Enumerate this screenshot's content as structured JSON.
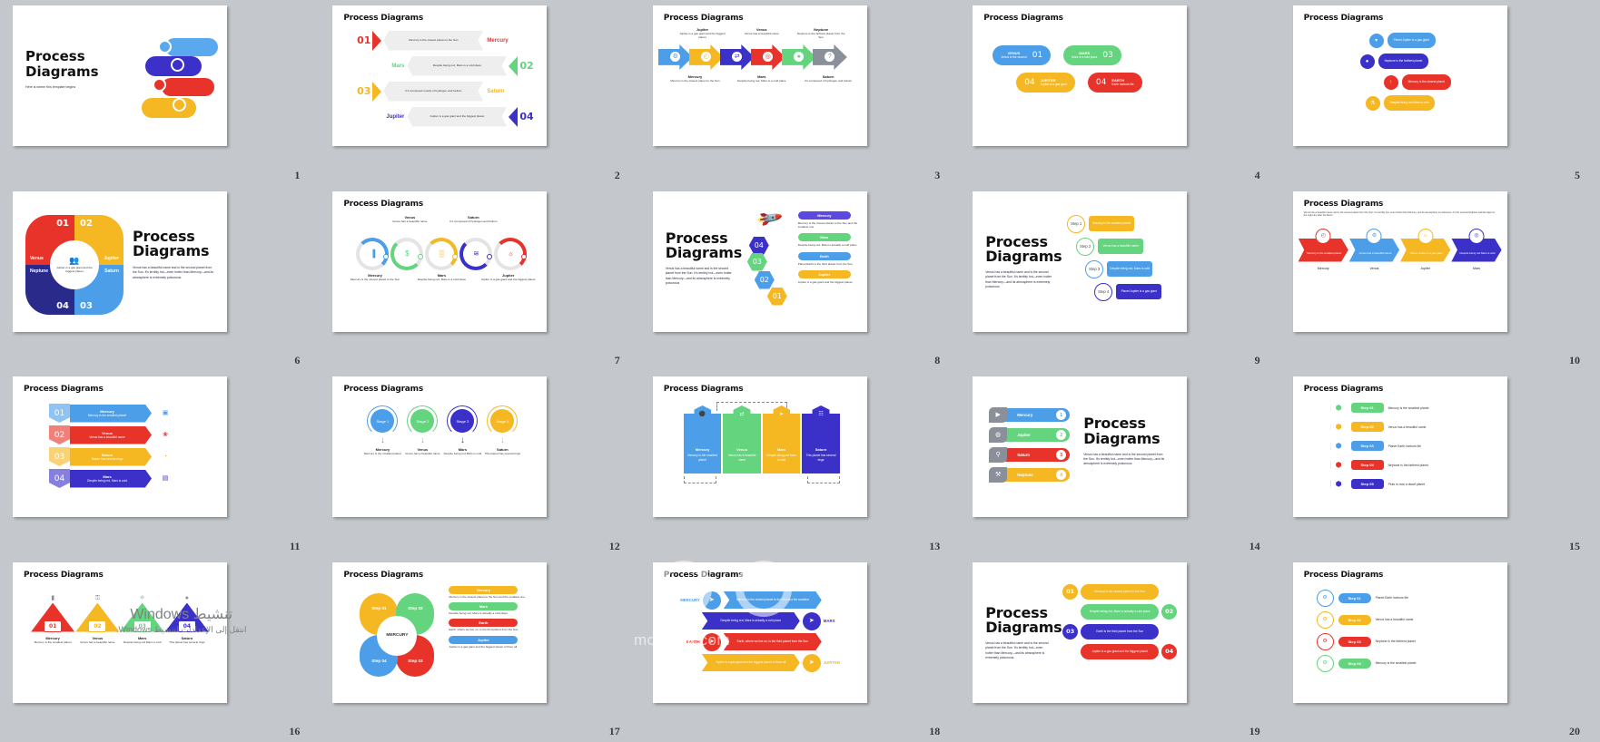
{
  "app": {
    "background_color": "#c4c8cc",
    "slide_count": 20
  },
  "common": {
    "title": "Process Diagrams",
    "lorem": "Venus has a beautiful  name and is the second planet  from the Sun. It's terribly hot—even hotter than Mercury—and its atmosphere  is extremely poisonous"
  },
  "watermark": {
    "text": "mostaqil.com",
    "windows_line1": "تنشيط Windows",
    "windows_line2": "انتقل إلى الإعدادات لتنشيط Windows."
  },
  "colors": {
    "blue": "#4d9ee8",
    "yellow": "#f5b722",
    "indigo": "#3b31c9",
    "red": "#e8332a",
    "green": "#64d47e",
    "gray": "#8a9099",
    "darkblue": "#2a2a8a",
    "purple": "#5b4ae0"
  },
  "planets": {
    "mercury": {
      "name": "Mercury",
      "desc": "Mercury is the closest planet to the Sun"
    },
    "venus": {
      "name": "Venus",
      "desc": "Venus has a beautiful name"
    },
    "mars": {
      "name": "Mars",
      "desc": "Despite being red, Mars is a cold place"
    },
    "saturn": {
      "name": "Saturn",
      "desc": "It's composed mostly of hydrogen and helium"
    },
    "jupiter": {
      "name": "Jupiter",
      "desc": "Jupiter is a gas giant and the biggest planet"
    },
    "neptune": {
      "name": "Neptune",
      "desc": "Neptune is the farthest planet from the Sun"
    },
    "earth": {
      "name": "Earth",
      "desc": "Planet Earth is the third planet from the Sun"
    }
  },
  "slides": [
    {
      "number": "1",
      "layout": "cover",
      "title_line1": "Process",
      "title_line2": "Diagrams",
      "subtitle": "Here is where this template begins"
    },
    {
      "number": "2",
      "layout": "arrows-alt",
      "title": "Process Diagrams",
      "items": [
        {
          "num": "01",
          "label": "Mercury",
          "desc": "Mercury is the closest planet to the Sun",
          "color": "#e8332a",
          "dir": "right"
        },
        {
          "num": "02",
          "label": "Mars",
          "desc": "Despite being red, Mars is a cold place",
          "color": "#64d47e",
          "dir": "left"
        },
        {
          "num": "03",
          "label": "Saturn",
          "desc": "It's composed mostly of hydrogen and helium",
          "color": "#f5b722",
          "dir": "right"
        },
        {
          "num": "04",
          "label": "Jupiter",
          "desc": "Jupiter is a gas giant and the biggest planet",
          "color": "#3b31c9",
          "dir": "left"
        }
      ]
    },
    {
      "number": "3",
      "layout": "chevron-row",
      "title": "Process Diagrams",
      "top": [
        {
          "label": "Jupiter",
          "desc": "Jupiter is a gas giant and the biggest planet"
        },
        {
          "label": "Venus",
          "desc": "Venus has a beautiful name"
        },
        {
          "label": "Neptune",
          "desc": "Neptune is the farthest planet from the Sun"
        }
      ],
      "bottom": [
        {
          "label": "Mercury",
          "desc": "Mercury is the closest planet to the Sun"
        },
        {
          "label": "Mars",
          "desc": "Despite being red, Mars is a cold place"
        },
        {
          "label": "Saturn",
          "desc": "It's composed of hydrogen and helium"
        }
      ],
      "arrow_colors": [
        "#4d9ee8",
        "#f5b722",
        "#3b31c9",
        "#e8332a",
        "#64d47e",
        "#8a9099"
      ],
      "icons": [
        "gear-icon",
        "clock-icon",
        "share-icon",
        "target-icon",
        "globe-icon",
        "question-icon"
      ]
    },
    {
      "number": "4",
      "layout": "pill-flow",
      "title": "Process Diagrams",
      "items": [
        {
          "num": "01",
          "label": "VENUS",
          "desc": "Venus is the second",
          "color": "#4d9ee8"
        },
        {
          "num": "03",
          "label": "MARS",
          "desc": "Mars is a cold place",
          "color": "#64d47e"
        },
        {
          "num": "04",
          "label": "JUPITER",
          "desc": "Jupiter is a gas giant",
          "color": "#f5b722"
        },
        {
          "num": "04",
          "label": "EARTH",
          "desc": "Earth harbors life",
          "color": "#e8332a"
        }
      ]
    },
    {
      "number": "5",
      "layout": "bubble-list",
      "title": "Process Diagrams",
      "items": [
        {
          "desc": "Planet Jupiter is a gas giant",
          "color": "#4d9ee8",
          "icon": "pin-icon"
        },
        {
          "desc": "Neptune is the farthest planet",
          "color": "#3b31c9",
          "icon": "globe-icon"
        },
        {
          "desc": "Mercury is the closest planet",
          "color": "#e8332a",
          "icon": "rocket-icon"
        },
        {
          "desc": "Despite being red Mars is cold",
          "color": "#f5b722",
          "icon": "flask-icon"
        }
      ]
    },
    {
      "number": "6",
      "layout": "pinwheel",
      "title_line1": "Process",
      "title_line2": "Diagrams",
      "center": "Jupiter is a gas giant and the biggest planet",
      "items": [
        {
          "num": "01",
          "label": "Venus",
          "color": "#e8332a"
        },
        {
          "num": "02",
          "label": "Jupiter",
          "color": "#f5b722"
        },
        {
          "num": "03",
          "label": "Saturn",
          "color": "#4d9ee8"
        },
        {
          "num": "04",
          "label": "Neptune",
          "color": "#2a2a8a"
        }
      ]
    },
    {
      "number": "7",
      "layout": "circles-5",
      "title": "Process Diagrams",
      "items": [
        {
          "label": "Mercury",
          "desc": "Mercury is the closest planet to the Sun",
          "color": "#4d9ee8",
          "pos": "bottom",
          "icon": "chart-icon"
        },
        {
          "label": "Venus",
          "desc": "Venus has a beautiful name",
          "color": "#64d47e",
          "pos": "top",
          "icon": "money-icon"
        },
        {
          "label": "Mars",
          "desc": "Despite being red, Mars is a cold place",
          "color": "#f5b722",
          "pos": "bottom",
          "icon": "building-icon"
        },
        {
          "label": "Saturn",
          "desc": "It's composed of hydrogen and helium",
          "color": "#3b31c9",
          "pos": "top",
          "icon": "handshake-icon"
        },
        {
          "label": "Jupiter",
          "desc": "Jupiter is a gas giant and the biggest planet",
          "color": "#e8332a",
          "pos": "bottom",
          "icon": "bulb-icon"
        }
      ]
    },
    {
      "number": "8",
      "layout": "rocket",
      "title_line1": "Process",
      "title_line2": "Diagrams",
      "steps": [
        {
          "num": "01",
          "color": "#f5b722"
        },
        {
          "num": "02",
          "color": "#4d9ee8"
        },
        {
          "num": "03",
          "color": "#64d47e"
        },
        {
          "num": "04",
          "color": "#3b31c9"
        }
      ],
      "items": [
        {
          "label": "Mercury",
          "desc": "Mercury is the closest planet to the Sun and the smallest one",
          "color": "#5b4ae0"
        },
        {
          "label": "Mars",
          "desc": "Despite being red, Mars is actually a cold place",
          "color": "#64d47e"
        },
        {
          "label": "Earth",
          "desc": "Planet Earth is the third planet from the Sun",
          "color": "#4d9ee8"
        },
        {
          "label": "Jupiter",
          "desc": "Jupiter is a gas giant and the biggest planet",
          "color": "#f5b722"
        }
      ]
    },
    {
      "number": "9",
      "layout": "steps-4",
      "title_line1": "Process",
      "title_line2": "Diagrams",
      "items": [
        {
          "step": "Step 1",
          "desc": "Mercury is the smallest planet",
          "color": "#f5b722"
        },
        {
          "step": "Step 2",
          "desc": "Venus has a beautiful name",
          "color": "#64d47e"
        },
        {
          "step": "Step 3",
          "desc": "Despite being red, Mars is cold",
          "color": "#4d9ee8"
        },
        {
          "step": "Step 4",
          "desc": "Planet Jupiter is a gas giant",
          "color": "#3b31c9"
        }
      ]
    },
    {
      "number": "10",
      "layout": "arrow-chain",
      "title": "Process Diagrams",
      "subtitle": "Venus has a beautiful name and is the second planet from the Sun. It's terribly hot, even hotter than Mercury, and its atmosphere is poisonous. It's the second-brightest natural object in the night sky after the Moon",
      "items": [
        {
          "desc": "Mercury is the smallest planet",
          "label": "Mercury",
          "color": "#e8332a",
          "icon": "clock-icon"
        },
        {
          "desc": "Venus has a beautiful name",
          "label": "Venus",
          "color": "#4d9ee8",
          "icon": "gear-icon"
        },
        {
          "desc": "Planet Jupiter is a gas giant",
          "label": "Jupiter",
          "color": "#f5b722",
          "icon": "bulb-icon"
        },
        {
          "desc": "Despite being red Mars is cold",
          "label": "Mars",
          "color": "#3b31c9",
          "icon": "target-icon"
        }
      ]
    },
    {
      "number": "11",
      "layout": "num-bars",
      "title": "Process Diagrams",
      "items": [
        {
          "num": "01",
          "label": "Mercury",
          "desc": "Mercury is the smallest planet",
          "color": "#4d9ee8",
          "icon": "robot-icon"
        },
        {
          "num": "02",
          "label": "Venus",
          "desc": "Venus has a beautiful name",
          "color": "#e8332a",
          "icon": "flower-icon"
        },
        {
          "num": "03",
          "label": "Saturn",
          "desc": "Saturn has several rings",
          "color": "#f5b722",
          "icon": "snail-icon"
        },
        {
          "num": "04",
          "label": "Mars",
          "desc": "Despite being red, Mars is cold",
          "color": "#3b31c9",
          "icon": "book-icon"
        }
      ]
    },
    {
      "number": "12",
      "layout": "stage-circles",
      "title": "Process Diagrams",
      "items": [
        {
          "stage": "Stage 1",
          "label": "Mercury",
          "desc": "Mercury is the smallest planet",
          "color": "#4d9ee8"
        },
        {
          "stage": "Stage 2",
          "label": "Venus",
          "desc": "Venus has a beautiful name",
          "color": "#64d47e"
        },
        {
          "stage": "Stage 3",
          "label": "Mars",
          "desc": "Despite being red Mars is cold",
          "color": "#3b31c9"
        },
        {
          "stage": "Stage 4",
          "label": "Saturn",
          "desc": "This planet has several rings",
          "color": "#f5b722"
        }
      ]
    },
    {
      "number": "13",
      "layout": "columns-hex",
      "title": "Process Diagrams",
      "items": [
        {
          "label": "Mercury",
          "desc": "Mercury is the smallest planet",
          "color": "#4d9ee8",
          "icon": "person-icon"
        },
        {
          "label": "Venus",
          "desc": "Venus has a beautiful name",
          "color": "#64d47e",
          "icon": "shuffle-icon"
        },
        {
          "label": "Mars",
          "desc": "Despite being red Mars is cold",
          "color": "#f5b722",
          "icon": "send-icon"
        },
        {
          "label": "Saturn",
          "desc": "This planet has several rings",
          "color": "#3b31c9",
          "icon": "bank-icon"
        }
      ]
    },
    {
      "number": "14",
      "layout": "icon-bars",
      "title_line1": "Process",
      "title_line2": "Diagrams",
      "items": [
        {
          "label": "Mercury",
          "num": "1",
          "color": "#4d9ee8",
          "icon": "megaphone-icon"
        },
        {
          "label": "Jupiter",
          "num": "2",
          "color": "#64d47e",
          "icon": "chat-icon"
        },
        {
          "label": "Saturn",
          "num": "3",
          "color": "#e8332a",
          "icon": "search-icon"
        },
        {
          "label": "Neptune",
          "num": "4",
          "color": "#f5b722",
          "icon": "tools-icon"
        }
      ]
    },
    {
      "number": "15",
      "layout": "hex-steps",
      "title": "Process Diagrams",
      "items": [
        {
          "step": "Step 01",
          "desc": "Mercury is the smallest planet",
          "color": "#64d47e",
          "icon": "gear-icon"
        },
        {
          "step": "Step 02",
          "desc": "Venus has a beautiful name",
          "color": "#f5b722",
          "icon": "clock-icon"
        },
        {
          "step": "Step 03",
          "desc": "Planet Earth harbors life",
          "color": "#4d9ee8",
          "icon": "cloud-icon"
        },
        {
          "step": "Step 04",
          "desc": "Neptune is the farthest planet",
          "color": "#e8332a",
          "icon": "box-icon"
        },
        {
          "step": "Step 05",
          "desc": "Pluto is now a dwarf planet",
          "color": "#3b31c9",
          "icon": "hex-icon"
        }
      ]
    },
    {
      "number": "16",
      "layout": "triangles",
      "title": "Process Diagrams",
      "items": [
        {
          "num": "01",
          "label": "Mercury",
          "desc": "Mercury is the smallest planet",
          "color": "#e8332a",
          "icon": "bag-icon"
        },
        {
          "num": "02",
          "label": "Venus",
          "desc": "Venus has a beautiful name",
          "color": "#f5b722",
          "icon": "lock-icon"
        },
        {
          "num": "03",
          "label": "Mars",
          "desc": "Despite being red Mars is cold",
          "color": "#64d47e",
          "icon": "atom-icon"
        },
        {
          "num": "04",
          "label": "Saturn",
          "desc": "This planet has several rings",
          "color": "#3b31c9",
          "icon": "sphere-icon"
        }
      ]
    },
    {
      "number": "17",
      "layout": "flower-steps",
      "title": "Process Diagrams",
      "center": "MERCURY",
      "steps": [
        {
          "step": "Step 01",
          "color": "#f5b722"
        },
        {
          "step": "Step 02",
          "color": "#64d47e"
        },
        {
          "step": "Step 03",
          "color": "#e8332a"
        },
        {
          "step": "Step 04",
          "color": "#4d9ee8"
        }
      ],
      "items": [
        {
          "label": "Mercury",
          "desc": "Mercury is the closest planet to the Sun and the smallest one",
          "color": "#f5b722"
        },
        {
          "label": "Mars",
          "desc": "Despite being red, Mars is actually a cold place",
          "color": "#64d47e"
        },
        {
          "label": "Earth",
          "desc": "Earth, where we live on, is the third planet from the Sun",
          "color": "#e8332a"
        },
        {
          "label": "Jupiter",
          "desc": "Jupiter is a gas giant and the biggest planet of them all",
          "color": "#4d9ee8"
        }
      ]
    },
    {
      "number": "18",
      "layout": "chevron-stack",
      "title": "Process Diagrams",
      "sides": [
        {
          "label": "MERCURY",
          "color": "#4d9ee8"
        },
        {
          "label": "MARS",
          "color": "#3b31c9"
        },
        {
          "label": "EARTH",
          "color": "#e8332a"
        },
        {
          "label": "JUPITER",
          "color": "#f5b722"
        }
      ],
      "items": [
        {
          "desc": "Mercury is the closest planet to the Sun and the smallest",
          "color": "#4d9ee8"
        },
        {
          "desc": "Despite being red, Mars is actually a cold place",
          "color": "#3b31c9"
        },
        {
          "desc": "Earth, where we live on, is the third planet from the Sun",
          "color": "#e8332a"
        },
        {
          "desc": "Jupiter is a gas giant and the biggest planet of them all",
          "color": "#f5b722"
        }
      ]
    },
    {
      "number": "19",
      "layout": "numbered-bubbles",
      "title_line1": "Process",
      "title_line2": "Diagrams",
      "items": [
        {
          "num": "01",
          "desc": "Mercury is the closest planet to the Sun",
          "color": "#f5b722"
        },
        {
          "num": "02",
          "desc": "Despite being red, Mars is actually a cold place",
          "color": "#64d47e"
        },
        {
          "num": "03",
          "desc": "Earth is the third planet from the Sun",
          "color": "#3b31c9"
        },
        {
          "num": "04",
          "desc": "Jupiter is a gas giant and the biggest planet",
          "color": "#e8332a"
        }
      ]
    },
    {
      "number": "20",
      "layout": "circle-steps",
      "title": "Process Diagrams",
      "items": [
        {
          "step": "Step 01",
          "desc": "Planet Earth harbors life",
          "color": "#4d9ee8"
        },
        {
          "step": "Step 02",
          "desc": "Venus has a beautiful name",
          "color": "#f5b722"
        },
        {
          "step": "Step 03",
          "desc": "Neptune is the farthest planet",
          "color": "#e8332a"
        },
        {
          "step": "Step 04",
          "desc": "Mercury is the smallest planet",
          "color": "#64d47e"
        }
      ]
    }
  ]
}
